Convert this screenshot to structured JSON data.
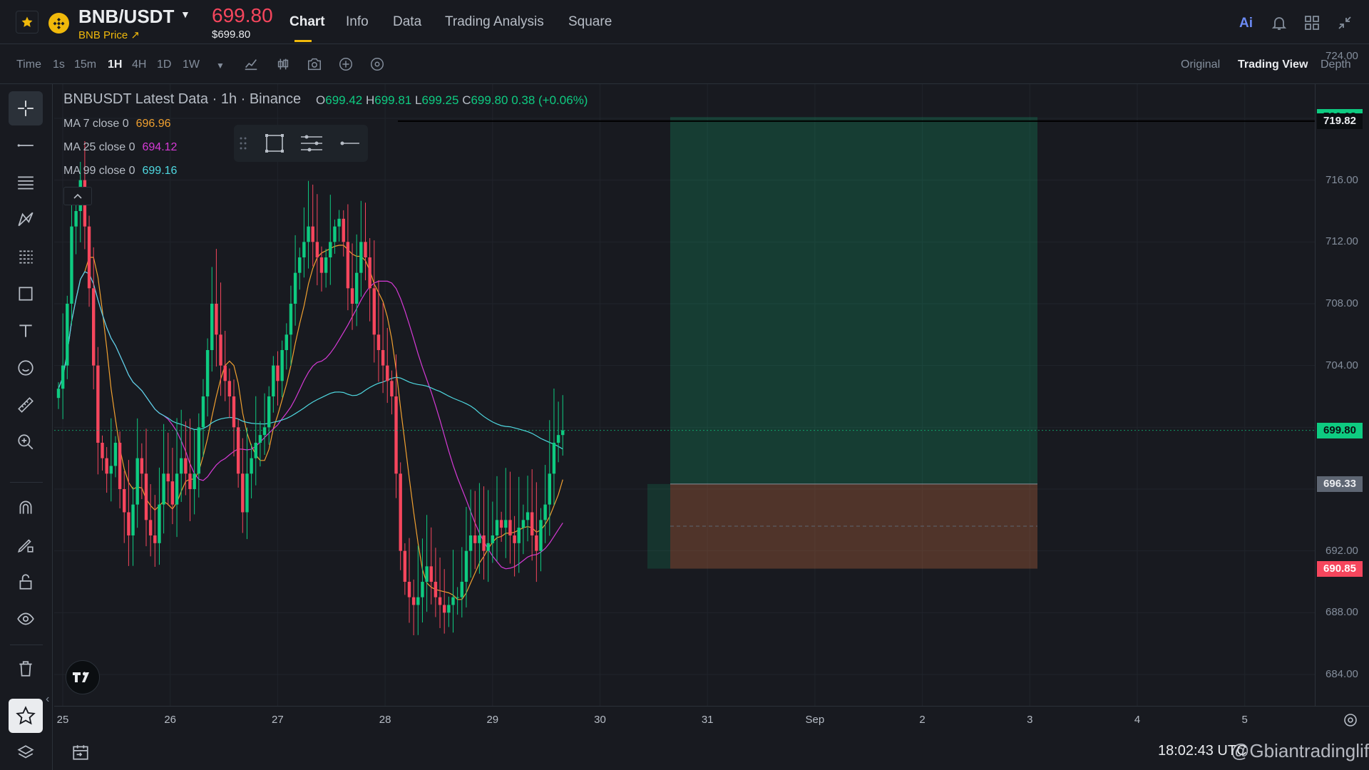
{
  "header": {
    "symbol": "BNB/USDT",
    "symbol_sub": "BNB Price ↗",
    "last_price": "699.80",
    "last_price_usd": "$699.80",
    "tabs": [
      "Chart",
      "Info",
      "Data",
      "Trading Analysis",
      "Square"
    ],
    "icons": [
      "ai-icon",
      "bell-icon",
      "layout-icon",
      "collapse-icon"
    ],
    "ai_label": "Ai"
  },
  "toolbar": {
    "timeframes": [
      "Time",
      "1s",
      "15m",
      "1H",
      "4H",
      "1D",
      "1W"
    ],
    "active_timeframe": "1H",
    "views": [
      "Original",
      "Trading View",
      "Depth"
    ],
    "active_view": "Trading View"
  },
  "legend": {
    "title": "BNBUSDT Latest Data · 1h · Binance",
    "o_label": "O",
    "o": "699.42",
    "h_label": "H",
    "h": "699.81",
    "l_label": "L",
    "l": "699.25",
    "c_label": "C",
    "c": "699.80",
    "change": "0.38 (+0.06%)",
    "ma": [
      {
        "label": "MA 7 close 0",
        "value": "696.96",
        "color": "#f0a030"
      },
      {
        "label": "MA 25 close 0",
        "value": "694.12",
        "color": "#d63ad6"
      },
      {
        "label": "MA 99 close 0",
        "value": "699.16",
        "color": "#4fd8e0"
      }
    ]
  },
  "axis": {
    "price_ticks": [
      "724.00",
      "720.00",
      "716.00",
      "712.00",
      "708.00",
      "704.00",
      "700.00",
      "696.00",
      "692.00",
      "688.00",
      "684.00"
    ],
    "time_ticks": [
      "25",
      "26",
      "27",
      "28",
      "29",
      "30",
      "31",
      "Sep",
      "2",
      "3",
      "4",
      "5"
    ]
  },
  "price_tags": [
    {
      "value": "720.08",
      "bg": "#0ecb81",
      "fg": "#0b0e11"
    },
    {
      "value": "719.82",
      "bg": "#0b0e11",
      "fg": "#eaecef"
    },
    {
      "value": "699.80",
      "bg": "#0ecb81",
      "fg": "#0b0e11"
    },
    {
      "value": "696.33",
      "bg": "#5e6673",
      "fg": "#eaecef"
    },
    {
      "value": "690.85",
      "bg": "#f6465d",
      "fg": "#ffffff"
    }
  ],
  "position_tool": {
    "target": 720.08,
    "entry": 696.33,
    "stop": 690.85
  },
  "colors": {
    "up": "#0ecb81",
    "down": "#f6465d",
    "accent": "#f0b90b"
  },
  "bottom": {
    "clock": "18:02:43 UTC",
    "watermark": "@Gbiantradinglife"
  },
  "chart_data": {
    "type": "candlestick",
    "title": "BNBUSDT Latest Data · 1h · Binance",
    "x_ticks": [
      "25",
      "26",
      "27",
      "28",
      "29",
      "30",
      "31",
      "Sep",
      "2",
      "3",
      "4",
      "5"
    ],
    "ylim": [
      682,
      725
    ],
    "y_ticks": [
      684,
      688,
      692,
      696,
      700,
      704,
      708,
      712,
      716,
      720,
      724
    ],
    "close_series": [
      702.5,
      704,
      708,
      713,
      714,
      716,
      713,
      709,
      704,
      699,
      698,
      697,
      697.5,
      699,
      696,
      694.5,
      693,
      695,
      698,
      697,
      694,
      693,
      692.5,
      695,
      697,
      696.5,
      695,
      697,
      698,
      697,
      696,
      697,
      700,
      702,
      705,
      708,
      706,
      704,
      703,
      702,
      700,
      697,
      694.5,
      697,
      698,
      699,
      699.5,
      700,
      702,
      704,
      703,
      705,
      706,
      708,
      710,
      711,
      712,
      713,
      712,
      711,
      710,
      711,
      712,
      713,
      713.5,
      712,
      709,
      708,
      710,
      712,
      711,
      709,
      706,
      705,
      704,
      703,
      702,
      697,
      692,
      690,
      689,
      688.5,
      689,
      690,
      691,
      690,
      689,
      688.5,
      688,
      688.5,
      689,
      689,
      690,
      692,
      693,
      692.5,
      693,
      692,
      692.5,
      693,
      694,
      693.5,
      694,
      693,
      692.5,
      693.5,
      694,
      694.5,
      693,
      692,
      694,
      695,
      697,
      699,
      699.5,
      699.8
    ]
  }
}
